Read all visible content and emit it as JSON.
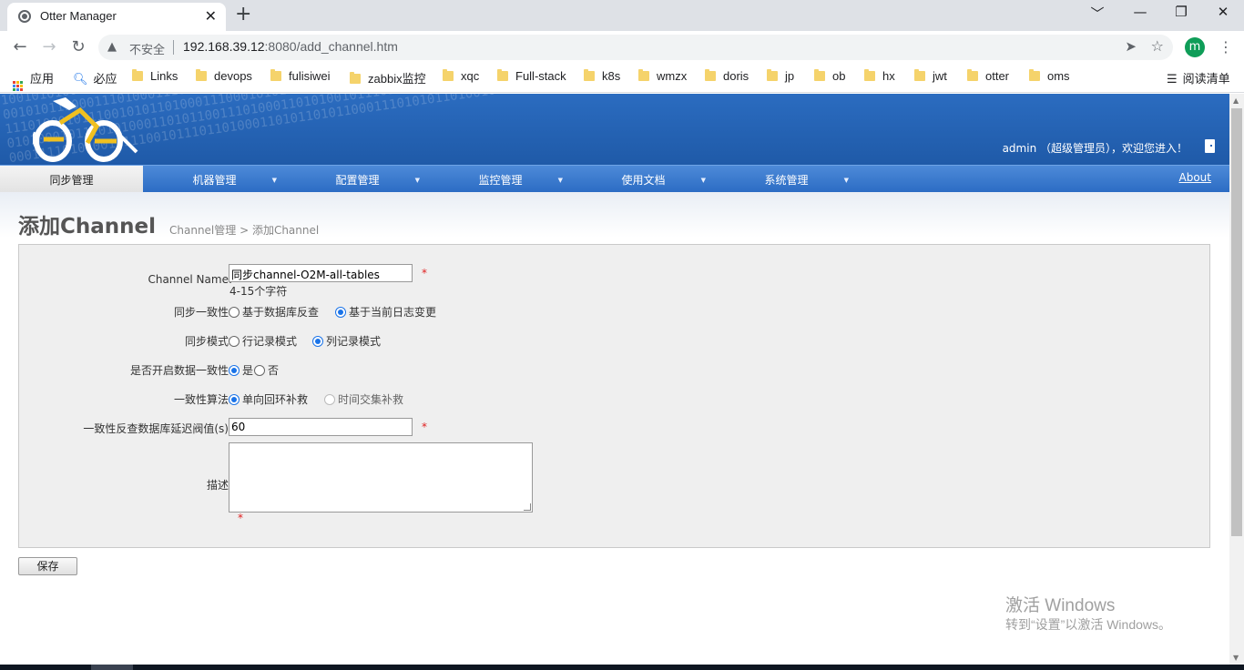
{
  "browser": {
    "tab_title": "Otter Manager",
    "tab_close": "✕",
    "new_tab": "+",
    "window_controls": {
      "minimize": "﹀",
      "restore": "—",
      "maximize": "❐",
      "close": "✕"
    },
    "nav": {
      "back": "←",
      "forward": "→",
      "reload": "↻"
    },
    "insecure_label": "不安全",
    "url_host": "192.168.39.12",
    "url_path": ":8080/add_channel.htm",
    "profile_initial": "m",
    "menu": "⋮",
    "bookmarks": [
      {
        "label": "应用",
        "type": "apps"
      },
      {
        "label": "必应",
        "type": "search"
      },
      {
        "label": "Links",
        "type": "folder"
      },
      {
        "label": "devops",
        "type": "folder"
      },
      {
        "label": "fulisiwei",
        "type": "folder"
      },
      {
        "label": "zabbix监控",
        "type": "folder"
      },
      {
        "label": "xqc",
        "type": "folder"
      },
      {
        "label": "Full-stack",
        "type": "folder"
      },
      {
        "label": "k8s",
        "type": "folder"
      },
      {
        "label": "wmzx",
        "type": "folder"
      },
      {
        "label": "doris",
        "type": "folder"
      },
      {
        "label": "jp",
        "type": "folder"
      },
      {
        "label": "ob",
        "type": "folder"
      },
      {
        "label": "hx",
        "type": "folder"
      },
      {
        "label": "jwt",
        "type": "folder"
      },
      {
        "label": "otter",
        "type": "folder"
      },
      {
        "label": "oms",
        "type": "folder"
      }
    ],
    "reading_list": "阅读清单"
  },
  "header": {
    "welcome": "admin （超级管理员），欢迎您进入！",
    "menu": [
      {
        "label": "同步管理",
        "active": true,
        "dropdown": false
      },
      {
        "label": "机器管理",
        "active": false,
        "dropdown": true
      },
      {
        "label": "配置管理",
        "active": false,
        "dropdown": true
      },
      {
        "label": "监控管理",
        "active": false,
        "dropdown": true
      },
      {
        "label": "使用文档",
        "active": false,
        "dropdown": true
      },
      {
        "label": "系统管理",
        "active": false,
        "dropdown": true
      }
    ],
    "about": "About"
  },
  "page": {
    "title": "添加Channel",
    "breadcrumb": "Channel管理 > 添加Channel"
  },
  "form": {
    "channel_name": {
      "label": "Channel Name:",
      "value": "同步channel-O2M-all-tables",
      "hint": "4-15个字符",
      "required": "*"
    },
    "consistency": {
      "label": "同步一致性:",
      "options": [
        "基于数据库反查",
        "基于当前日志变更"
      ],
      "selected": 1
    },
    "sync_mode": {
      "label": "同步模式:",
      "options": [
        "行记录模式",
        "列记录模式"
      ],
      "selected": 1
    },
    "enable_consistency": {
      "label": "是否开启数据一致性:",
      "options": [
        "是",
        "否"
      ],
      "selected": 0
    },
    "algorithm": {
      "label": "一致性算法:",
      "options": [
        "单向回环补救",
        "时间交集补救"
      ],
      "selected": 0,
      "disabled": [
        1
      ]
    },
    "delay_threshold": {
      "label": "一致性反查数据库延迟阀值(s):",
      "value": "60",
      "required": "*"
    },
    "description": {
      "label": "描述:",
      "value": "",
      "required": "*"
    },
    "save_label": "保存"
  },
  "watermark": {
    "line1": "激活 Windows",
    "line2": "转到“设置”以激活 Windows。"
  },
  "colors": {
    "banner": "#1f5aa8",
    "menu": "#2c6cc4",
    "radio_selected": "#1a73e8",
    "required": "#e02020"
  }
}
